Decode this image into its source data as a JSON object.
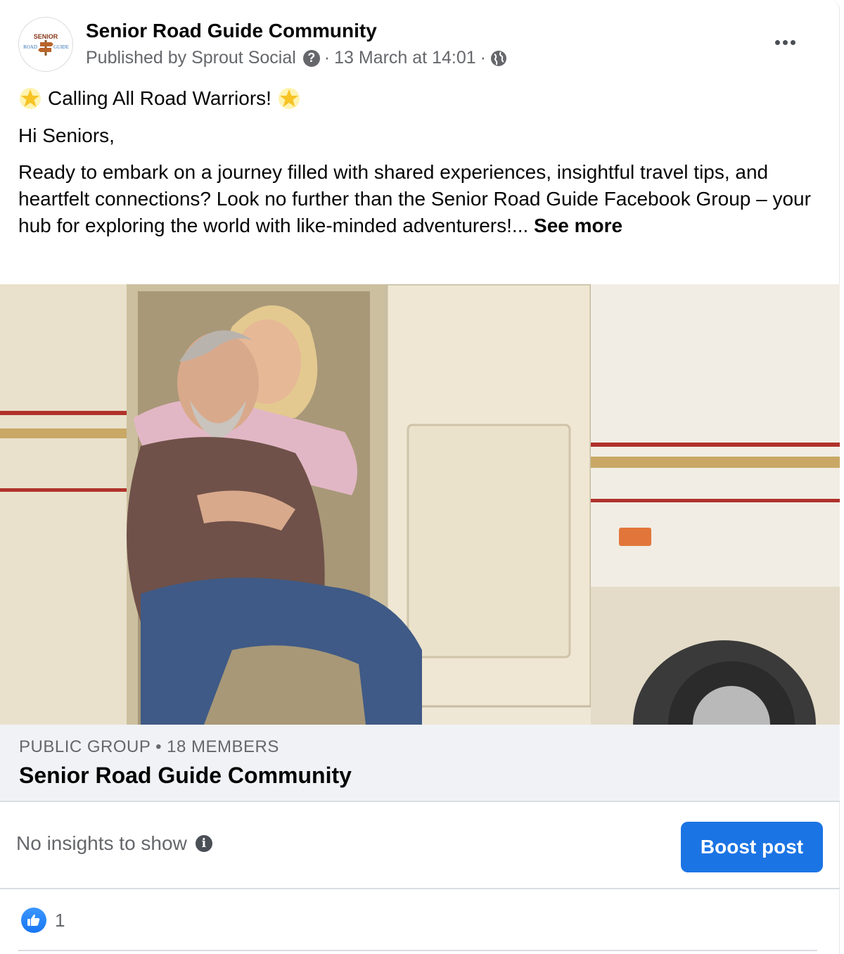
{
  "post": {
    "page_name": "Senior Road Guide Community",
    "avatar_text": {
      "line1": "SENIOR",
      "line2_left": "ROAD",
      "line2_right": "GUIDE"
    },
    "published_by": "Published by Sprout Social",
    "help_glyph": "?",
    "separator": "·",
    "timestamp": "13 March at 14:01",
    "audience_icon": "globe-icon",
    "title_text": "Calling All Road Warriors!",
    "greeting": "Hi Seniors,",
    "body": "Ready to embark on a journey filled with shared experiences, insightful travel tips, and heartfelt connections? Look no further than the Senior Road Guide Facebook Group – your hub for exploring the world with like-minded adventurers!...",
    "see_more": "See more"
  },
  "group": {
    "meta": "PUBLIC GROUP • 18 MEMBERS",
    "name": "Senior Road Guide Community"
  },
  "insights": {
    "no_insights": "No insights to show",
    "info_glyph": "i",
    "boost_label": "Boost post"
  },
  "reactions": {
    "like_count": "1"
  },
  "colors": {
    "primary_button": "#1b74e4",
    "secondary_text": "#65676b",
    "link_preview_bg": "#f0f2f5"
  }
}
